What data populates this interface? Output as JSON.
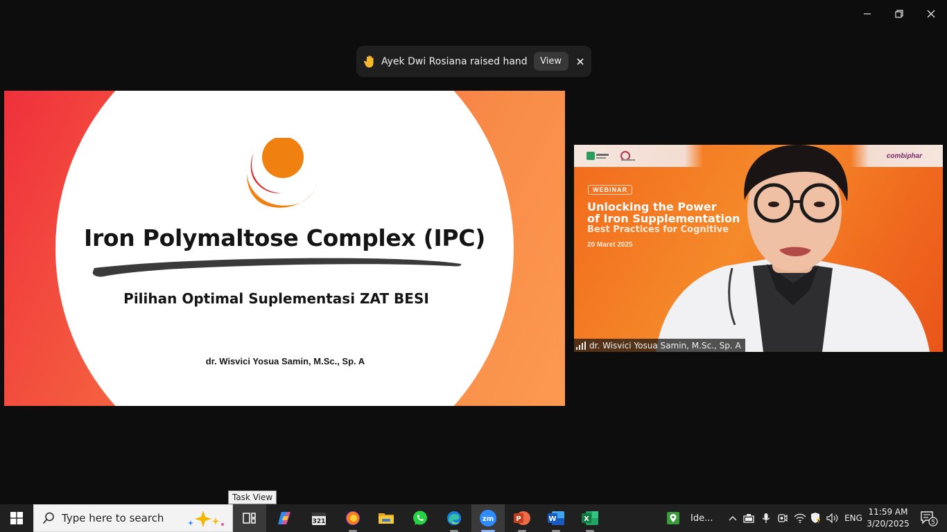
{
  "window": {
    "controls": {
      "minimize_icon": "minimize-icon",
      "restore_icon": "restore-icon",
      "close_icon": "close-icon"
    }
  },
  "notification": {
    "icon": "raised-hand-icon",
    "message": "Ayek Dwi Rosiana raised hand",
    "view_label": "View",
    "close_icon": "close-icon"
  },
  "slide": {
    "title": "Iron Polymaltose Complex (IPC)",
    "subtitle": "Pilihan Optimal Suplementasi ZAT BESI",
    "author": "dr. Wisvici Yosua Samin, M.Sc., Sp. A",
    "colors": {
      "gradient_start": "#f0303c",
      "gradient_end": "#fc9a50",
      "logo_orange": "#f08010",
      "logo_red": "#e02020"
    }
  },
  "video": {
    "webinar_tag": "WEBINAR",
    "headline_line1": "Unlocking the Power",
    "headline_line2": "of Iron Supplementation",
    "headline_line3": "Best Practices for Cognitive",
    "date": "20 Maret 2025",
    "brand": "combiphar",
    "participant_name": "dr. Wisvici Yosua Samin, M.Sc., Sp. A"
  },
  "tooltip": {
    "text": "Task View"
  },
  "taskbar": {
    "search_placeholder": "Type here to search",
    "apps": [
      {
        "name": "task-view",
        "icon": "task-view-icon"
      },
      {
        "name": "copilot",
        "icon": "copilot-icon"
      },
      {
        "name": "calendar",
        "icon": "calendar-icon"
      },
      {
        "name": "firefox",
        "icon": "firefox-icon"
      },
      {
        "name": "file-explorer",
        "icon": "folder-icon"
      },
      {
        "name": "whatsapp",
        "icon": "whatsapp-icon"
      },
      {
        "name": "edge",
        "icon": "edge-icon"
      },
      {
        "name": "zoom",
        "icon": "zoom-icon",
        "label": "zm"
      },
      {
        "name": "powerpoint",
        "icon": "powerpoint-icon",
        "label": "P"
      },
      {
        "name": "word",
        "icon": "word-icon",
        "label": "W"
      },
      {
        "name": "excel",
        "icon": "excel-icon",
        "label": "X"
      }
    ],
    "widget_label": "Ide...",
    "language": "ENG",
    "time": "11:59 AM",
    "date": "3/20/2025",
    "notification_count": "5"
  }
}
